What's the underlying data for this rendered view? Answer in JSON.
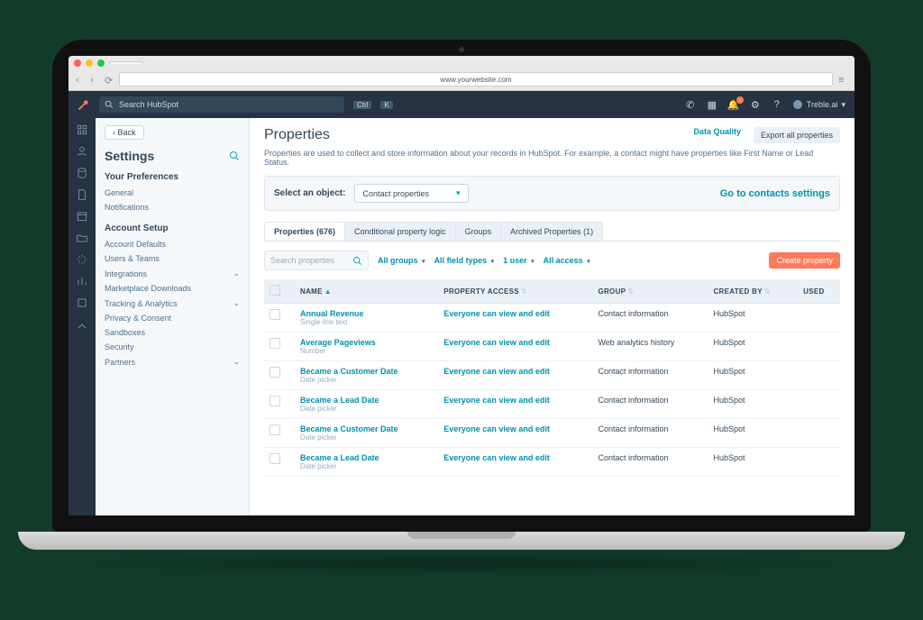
{
  "browser": {
    "url": "www.yourwebsite.com",
    "tab": " "
  },
  "topbar": {
    "search_placeholder": "Search HubSpot",
    "kbd_ctrl": "Ctrl",
    "kbd_k": "K",
    "account": "Treble.ai"
  },
  "sidebar": {
    "back": "Back",
    "title": "Settings",
    "group1": "Your Preferences",
    "items1": [
      "General",
      "Notifications"
    ],
    "group2": "Account Setup",
    "items2": [
      {
        "label": "Account Defaults",
        "chev": false
      },
      {
        "label": "Users & Teams",
        "chev": false
      },
      {
        "label": "Integrations",
        "chev": true
      },
      {
        "label": "Marketplace Downloads",
        "chev": false
      },
      {
        "label": "Tracking & Analytics",
        "chev": true
      },
      {
        "label": "Privacy & Consent",
        "chev": false
      },
      {
        "label": "Sandboxes",
        "chev": false
      },
      {
        "label": "Security",
        "chev": false
      },
      {
        "label": "Partners",
        "chev": true
      }
    ]
  },
  "main": {
    "title": "Properties",
    "data_quality": "Data Quality",
    "export": "Export all properties",
    "desc": "Properties are used to collect and store information about your records in HubSpot. For example, a contact might have properties like First Name or Lead Status.",
    "select_label": "Select an object:",
    "select_value": "Contact properties",
    "goto": "Go to contacts settings",
    "tabs": [
      "Properties (676)",
      "Conditional property logic",
      "Groups",
      "Archived Properties (1)"
    ],
    "search_ph": "Search properties",
    "filters": [
      "All groups",
      "All field types",
      "1 user",
      "All access"
    ],
    "create": "Create property",
    "cols": {
      "name": "NAME",
      "access": "PROPERTY ACCESS",
      "group": "GROUP",
      "created": "CREATED BY",
      "used": "USED"
    },
    "rows": [
      {
        "name": "Annual Revenue",
        "type": "Single-line text",
        "access": "Everyone can view and edit",
        "group": "Contact information",
        "created": "HubSpot"
      },
      {
        "name": "Average Pageviews",
        "type": "Number",
        "access": "Everyone can view and edit",
        "group": "Web analytics history",
        "created": "HubSpot"
      },
      {
        "name": "Became a Customer Date",
        "type": "Date picker",
        "access": "Everyone can view and edit",
        "group": "Contact information",
        "created": "HubSpot"
      },
      {
        "name": "Became a Lead Date",
        "type": "Date picker",
        "access": "Everyone can view and edit",
        "group": "Contact information",
        "created": "HubSpot"
      },
      {
        "name": "Became a Customer Date",
        "type": "Date picker",
        "access": "Everyone can view and edit",
        "group": "Contact information",
        "created": "HubSpot"
      },
      {
        "name": "Became a Lead Date",
        "type": "Date picker",
        "access": "Everyone can view and edit",
        "group": "Contact information",
        "created": "HubSpot"
      }
    ]
  }
}
